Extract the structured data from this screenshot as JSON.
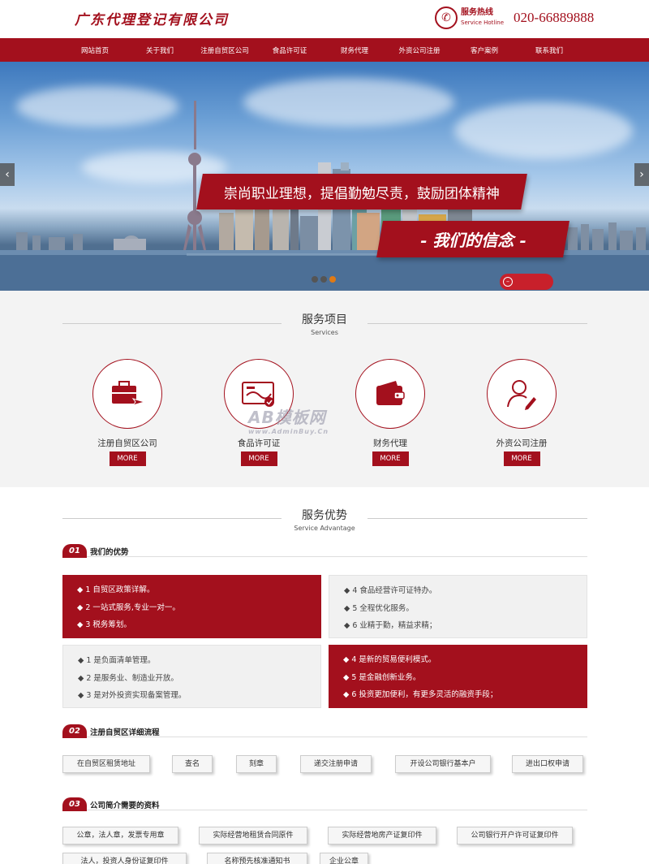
{
  "header": {
    "logo": "广东代理登记有限公司",
    "hotline_cn": "服务热线",
    "hotline_en": "Service Hotline",
    "hotline_number": "020-66889888"
  },
  "nav": [
    "网站首页",
    "关于我们",
    "注册自贸区公司",
    "食品许可证",
    "财务代理",
    "外资公司注册",
    "客户案例",
    "联系我们"
  ],
  "banner": {
    "slogan": "崇尚职业理想，提倡勤勉尽责，鼓励团体精神",
    "tagline": "- 我们的信念 -",
    "slides": 3,
    "active_slide": 3
  },
  "services": {
    "title": "服务项目",
    "subtitle": "Services",
    "more_label": "MORE",
    "items": [
      {
        "label": "注册自贸区公司",
        "icon": "briefcase-plane-icon"
      },
      {
        "label": "食品许可证",
        "icon": "certificate-icon"
      },
      {
        "label": "财务代理",
        "icon": "wallet-icon"
      },
      {
        "label": "外资公司注册",
        "icon": "user-pen-icon"
      }
    ]
  },
  "watermark": {
    "big": "AB模板网",
    "small": "www.AdminBuy.Cn"
  },
  "advantage": {
    "title": "服务优势",
    "subtitle": "Service Advantage",
    "section1": {
      "num": "01",
      "title": "我们的优势"
    },
    "box1": [
      "◆ 1 自贸区政策详解。",
      "◆ 2 一站式服务,专业一对一。",
      "◆ 3 税务筹划。"
    ],
    "box2": [
      "◆ 4 食品经营许可证特办。",
      "◆ 5 全程优化服务。",
      "◆ 6 业精于勤，精益求精；"
    ],
    "box3": [
      "◆ 1 是负面清单管理。",
      "◆ 2 是服务业、制造业开放。",
      "◆ 3 是对外投资实现备案管理。"
    ],
    "box4": [
      "◆ 4 是新的贸易便利模式。",
      "◆ 5 是金融创新业务。",
      "◆ 6 投资更加便利，有更多灵活的融资手段；"
    ],
    "section2": {
      "num": "02",
      "title": "注册自贸区详细流程"
    },
    "steps": [
      "在自贸区租赁地址",
      "查名",
      "刻章",
      "递交注册申请",
      "开设公司银行基本户",
      "进出口权申请"
    ],
    "section3": {
      "num": "03",
      "title": "公司简介需要的资料"
    },
    "docs": [
      "公章，法人章，发票专用章",
      "实际经营地租赁合同原件",
      "实际经营地房产证复印件",
      "公司银行开户许可证复印件",
      "法人，投资人身份证复印件",
      "名称预先核准通知书",
      "企业公章"
    ]
  },
  "colors": {
    "brand": "#a3101d",
    "accent_dot": "#e07a15"
  }
}
